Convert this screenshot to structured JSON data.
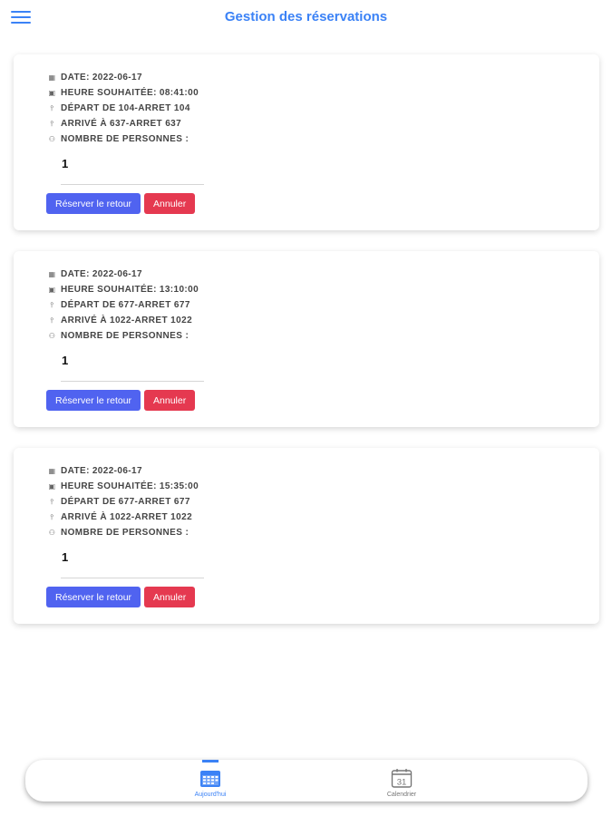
{
  "header": {
    "title": "Gestion des réservations",
    "menu_icon": "hamburger-menu-icon"
  },
  "labels": {
    "date": "DATE:",
    "heure": "HEURE SOUHAITÉE:",
    "depart": "DÉPART DE",
    "arrive": "ARRIVÉ À",
    "nombre": "NOMBRE DE PERSONNES :"
  },
  "reservations": [
    {
      "date": "2022-06-17",
      "heure": "08:41:00",
      "depart": "104-ARRET 104",
      "arrive": "637-ARRET 637",
      "personnes": "1",
      "return_label": "Réserver le retour",
      "cancel_label": "Annuler"
    },
    {
      "date": "2022-06-17",
      "heure": "13:10:00",
      "depart": "677-ARRET 677",
      "arrive": "1022-ARRET 1022",
      "personnes": "1",
      "return_label": "Réserver le retour",
      "cancel_label": "Annuler"
    },
    {
      "date": "2022-06-17",
      "heure": "15:35:00",
      "depart": "677-ARRET 677",
      "arrive": "1022-ARRET 1022",
      "personnes": "1",
      "return_label": "Réserver le retour",
      "cancel_label": "Annuler"
    }
  ],
  "tabs": {
    "today": {
      "label": "Aujourd'hui",
      "icon": "calendar-grid-icon",
      "active": true
    },
    "calendar": {
      "label": "Calendrier",
      "icon": "calendar-31-icon",
      "day": "31"
    }
  },
  "colors": {
    "accent": "#3b82f6",
    "primary_button": "#5063f0",
    "danger_button": "#e53950"
  }
}
